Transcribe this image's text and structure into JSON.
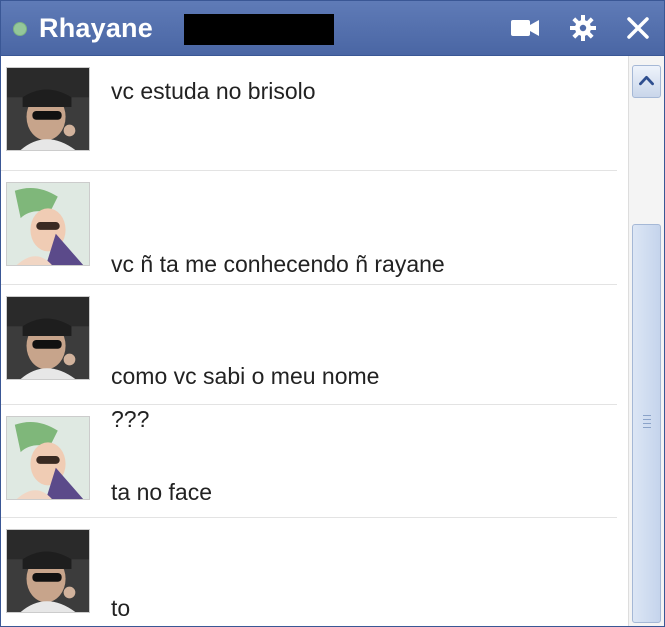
{
  "window": {
    "contact_name": "Rhayane",
    "status": "online",
    "accent_color": "#4a66a4"
  },
  "toolbar": {
    "icons": [
      "video-camera-icon",
      "gear-icon",
      "close-icon"
    ]
  },
  "messages": [
    {
      "sender": "contact-1",
      "lines": [
        "vc estuda no brisolo"
      ]
    },
    {
      "sender": "contact-2",
      "lines": [
        "vc ñ ta me conhecendo ñ rayane"
      ]
    },
    {
      "sender": "contact-1",
      "lines": [
        "como vc sabi o meu nome",
        "???"
      ]
    },
    {
      "sender": "contact-2",
      "lines": [
        "ta no face"
      ]
    },
    {
      "sender": "contact-1",
      "lines": [
        "to"
      ]
    }
  ],
  "scrollbar": {
    "position_fraction": 0.9
  }
}
